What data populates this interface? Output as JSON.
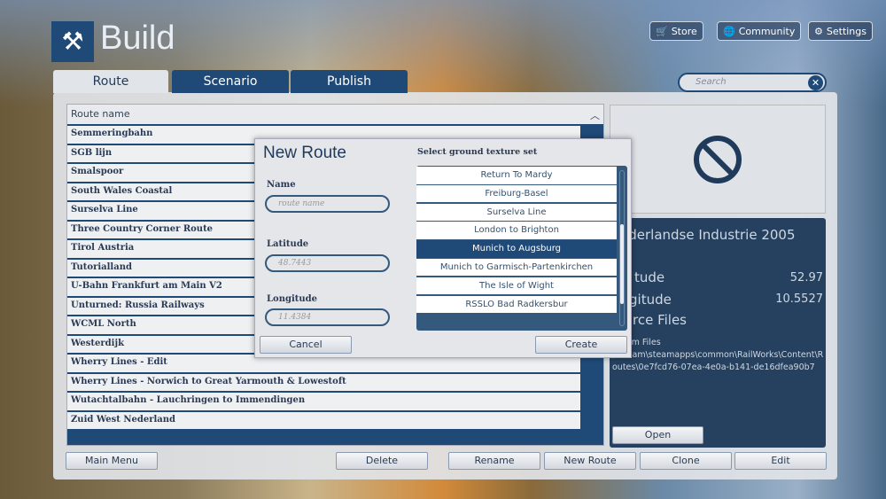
{
  "header": {
    "title": "Build",
    "store": "Store",
    "community": "Community",
    "settings": "Settings"
  },
  "tabs": [
    {
      "label": "Route"
    },
    {
      "label": "Scenario"
    },
    {
      "label": "Publish"
    }
  ],
  "search": {
    "placeholder": "Search"
  },
  "route_list": {
    "header": "Route name",
    "items": [
      "Semmeringbahn",
      "SGB lijn",
      "Smalspoor",
      "South Wales Coastal",
      "Surselva Line",
      "Three Country Corner Route",
      "Tirol Austria",
      "Tutorialland",
      "U-Bahn Frankfurt am Main V2",
      "Unturned: Russia Railways",
      "WCML North",
      "Westerdijk",
      "Wherry Lines - Edit",
      "Wherry Lines - Norwich to Great Yarmouth & Lowestoft",
      "Wutachtalbahn - Lauchringen to Immendingen",
      "Zuid West Nederland"
    ]
  },
  "details": {
    "name": "ederlandse Industrie 2005",
    "latitude_label": "tude",
    "latitude": "52.97",
    "longitude_label": "gitude",
    "longitude": "10.5527",
    "source_label": "rce Files",
    "path": "ogram Files\n)\\Steam\\steamapps\\common\\RailWorks\\Content\\Routes\\0e7fcd76-07ea-4e0a-b141-de16dfea90b7",
    "open": "Open"
  },
  "buttons": {
    "main_menu": "Main Menu",
    "delete": "Delete",
    "rename": "Rename",
    "new_route": "New Route",
    "clone": "Clone",
    "edit": "Edit"
  },
  "dialog": {
    "title": "New Route",
    "name_label": "Name",
    "name_placeholder": "route name",
    "latitude_label": "Latitude",
    "latitude_placeholder": "48.7443",
    "longitude_label": "Longitude",
    "longitude_placeholder": "11.4384",
    "texture_label": "Select ground texture set",
    "textures": [
      "Return To Mardy",
      "Freiburg-Basel",
      "Surselva Line",
      "London to Brighton",
      "Munich to Augsburg",
      "Munich to Garmisch-Partenkirchen",
      "The Isle of Wight",
      "RSSLO Bad Radkersbur"
    ],
    "selected": "Munich to Augsburg",
    "cancel": "Cancel",
    "create": "Create"
  },
  "colors": {
    "accent": "#1f4a78",
    "info_bg": "#25415f"
  }
}
